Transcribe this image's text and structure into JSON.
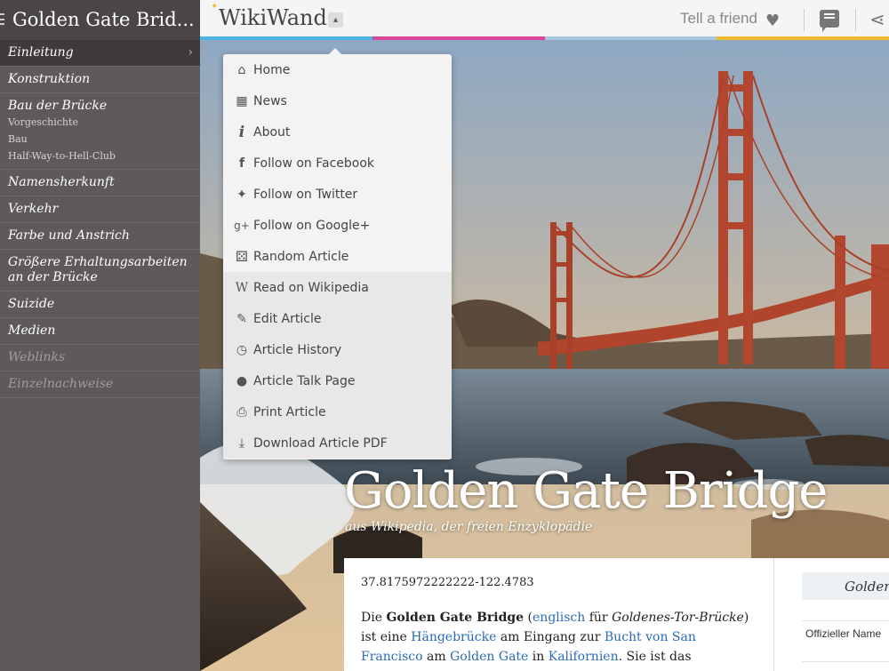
{
  "sidebar": {
    "title": "Golden Gate Brid...",
    "items": [
      {
        "label": "Einleitung",
        "active": true
      },
      {
        "label": "Konstruktion"
      },
      {
        "label": "Bau der Brücke",
        "subitems": [
          "Vorgeschichte",
          "Bau",
          "Half-Way-to-Hell-Club"
        ]
      },
      {
        "label": "Namensherkunft"
      },
      {
        "label": "Verkehr"
      },
      {
        "label": "Farbe und Anstrich"
      },
      {
        "label": "Größere Erhaltungsarbeiten an der Brücke"
      },
      {
        "label": "Suizide"
      },
      {
        "label": "Medien"
      },
      {
        "label": "Weblinks",
        "muted": true
      },
      {
        "label": "Einzelnachweise",
        "muted": true
      }
    ]
  },
  "header": {
    "logo": "WikiWand",
    "tell_friend": "Tell a friend",
    "strip_colors": [
      "#4cb5e3",
      "#d9489b",
      "#a9c7de",
      "#f1b92f"
    ]
  },
  "menu": {
    "items": [
      {
        "icon": "home-icon",
        "glyph": "⌂",
        "label": "Home"
      },
      {
        "icon": "calendar-icon",
        "glyph": "▦",
        "label": "News"
      },
      {
        "icon": "info-icon",
        "glyph": "i",
        "label": "About"
      },
      {
        "icon": "facebook-icon",
        "glyph": "f",
        "label": "Follow on Facebook"
      },
      {
        "icon": "twitter-icon",
        "glyph": "✦",
        "label": "Follow on Twitter"
      },
      {
        "icon": "google-plus-icon",
        "glyph": "g+",
        "label": "Follow on Google+"
      },
      {
        "icon": "dice-icon",
        "glyph": "⚄",
        "label": "Random Article"
      },
      {
        "icon": "wikipedia-icon",
        "glyph": "W",
        "label": "Read on Wikipedia"
      },
      {
        "icon": "pencil-icon",
        "glyph": "✎",
        "label": "Edit Article"
      },
      {
        "icon": "clock-icon",
        "glyph": "◷",
        "label": "Article History"
      },
      {
        "icon": "chat-icon",
        "glyph": "●",
        "label": "Article Talk Page"
      },
      {
        "icon": "printer-icon",
        "glyph": "⎙",
        "label": "Print Article"
      },
      {
        "icon": "download-icon",
        "glyph": "⤓",
        "label": "Download Article PDF"
      }
    ]
  },
  "hero": {
    "title": "Golden Gate Bridge",
    "subtitle": "aus Wikipedia, der freien Enzyklopädie"
  },
  "article": {
    "coords": "37.8175972222222-122.4783",
    "intro": {
      "p1": "Die ",
      "bold": "Golden Gate Bridge",
      "p2": " (",
      "link1": "englisch",
      "p3": " für ",
      "italic": "Goldenes-Tor-Brücke",
      "p4": ") ist eine ",
      "link2": "Hängebrücke",
      "p5": " am Eingang zur ",
      "link3": "Bucht von San Francisco",
      "p6": " am ",
      "link4": "Golden Gate",
      "p7": " in ",
      "link5": "Kalifornien",
      "p8": ". Sie ist das"
    }
  },
  "infobox": {
    "title": "Golden",
    "row_label": "Offizieller Name"
  }
}
